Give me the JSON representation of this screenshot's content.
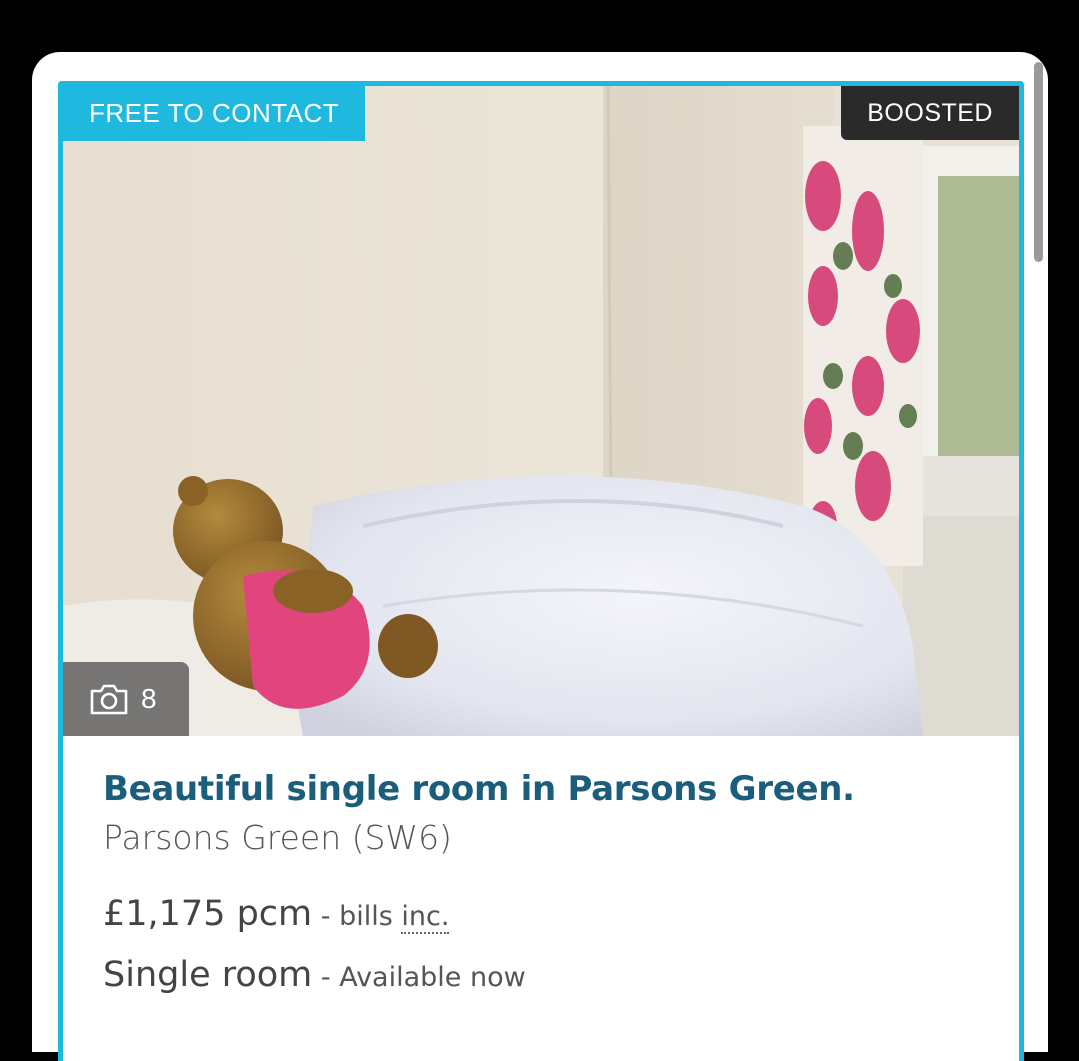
{
  "listing": {
    "badge_left": "FREE TO CONTACT",
    "badge_right": "BOOSTED",
    "photo_count": "8",
    "photo_count_icon": "camera-icon",
    "title": "Beautiful single room in Parsons Green.",
    "location": "Parsons Green (SW6)",
    "price": "£1,175 pcm",
    "price_sep": " - ",
    "bills": "bills ",
    "bills_abbr": "inc.",
    "room_type": "Single room",
    "availability_sep": " - ",
    "availability": "Available now"
  },
  "colors": {
    "accent": "#1fb9df",
    "title": "#1b5e7c",
    "boost_bg": "#2a2a2a"
  }
}
